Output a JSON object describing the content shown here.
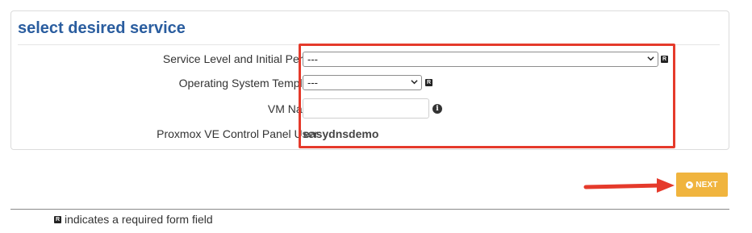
{
  "section": {
    "title": "select desired service"
  },
  "fields": {
    "service_level": {
      "label": "Service Level and Initial Period:",
      "value": "---"
    },
    "os_template": {
      "label": "Operating System Template:",
      "value": "---"
    },
    "vm_name": {
      "label": "VM Name:",
      "value": ""
    },
    "panel_user": {
      "label": "Proxmox VE Control Panel User:",
      "value": "easydnsdemo"
    }
  },
  "required_marker": "R",
  "info_marker": "i",
  "buttons": {
    "next_label": "NEXT"
  },
  "footer": {
    "note": "indicates a required form field"
  },
  "colors": {
    "title": "#2a5d9f",
    "highlight": "#e53a2b",
    "next_button": "#f0b43e"
  }
}
